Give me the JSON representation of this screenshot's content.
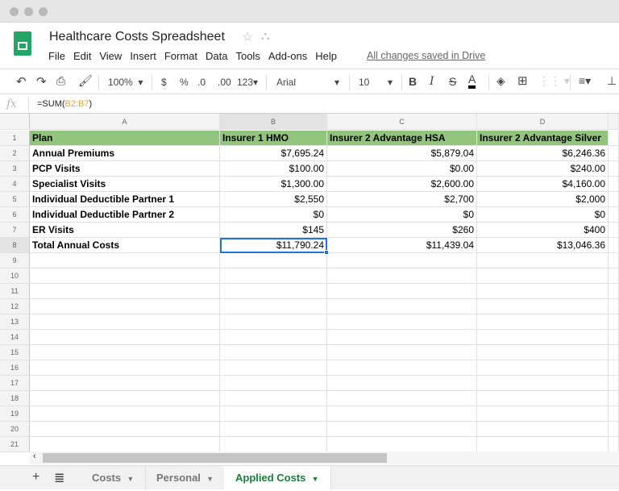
{
  "app": {
    "title": "Healthcare Costs Spreadsheet",
    "saved_status": "All changes saved in Drive"
  },
  "menu": [
    "File",
    "Edit",
    "View",
    "Insert",
    "Format",
    "Data",
    "Tools",
    "Add-ons",
    "Help"
  ],
  "toolbar": {
    "zoom": "100%",
    "currency": "$",
    "percent": "%",
    "dec_less": ".0",
    "dec_more": ".00",
    "format": "123",
    "font": "Arial",
    "font_size": "10",
    "bold": "B",
    "italic": "I",
    "strike": "S",
    "text_color": "A"
  },
  "formula_bar": {
    "label": "fx",
    "prefix": "=SUM(",
    "ref": "B2:B7",
    "suffix": ")"
  },
  "columns": [
    "A",
    "B",
    "C",
    "D"
  ],
  "rows": [
    [
      "Plan",
      "Insurer 1 HMO",
      "Insurer 2 Advantage HSA",
      "Insurer 2 Advantage Silver"
    ],
    [
      "Annual Premiums",
      "$7,695.24",
      "$5,879.04",
      "$6,246.36"
    ],
    [
      "PCP Visits",
      "$100.00",
      "$0.00",
      "$240.00"
    ],
    [
      "Specialist Visits",
      "$1,300.00",
      "$2,600.00",
      "$4,160.00"
    ],
    [
      "Individual Deductible Partner 1",
      "$2,550",
      "$2,700",
      "$2,000"
    ],
    [
      "Individual Deductible Partner 2",
      "$0",
      "$0",
      "$0"
    ],
    [
      "ER Visits",
      "$145",
      "$260",
      "$400"
    ],
    [
      "Total Annual Costs",
      "$11,790.24",
      "$11,439.04",
      "$13,046.36"
    ]
  ],
  "row_count": 21,
  "selected_cell": "B8",
  "header_color": "#93c47d",
  "sheets": [
    {
      "label": "Costs"
    },
    {
      "label": "Personal"
    },
    {
      "label": "Applied Costs",
      "active": true
    }
  ]
}
